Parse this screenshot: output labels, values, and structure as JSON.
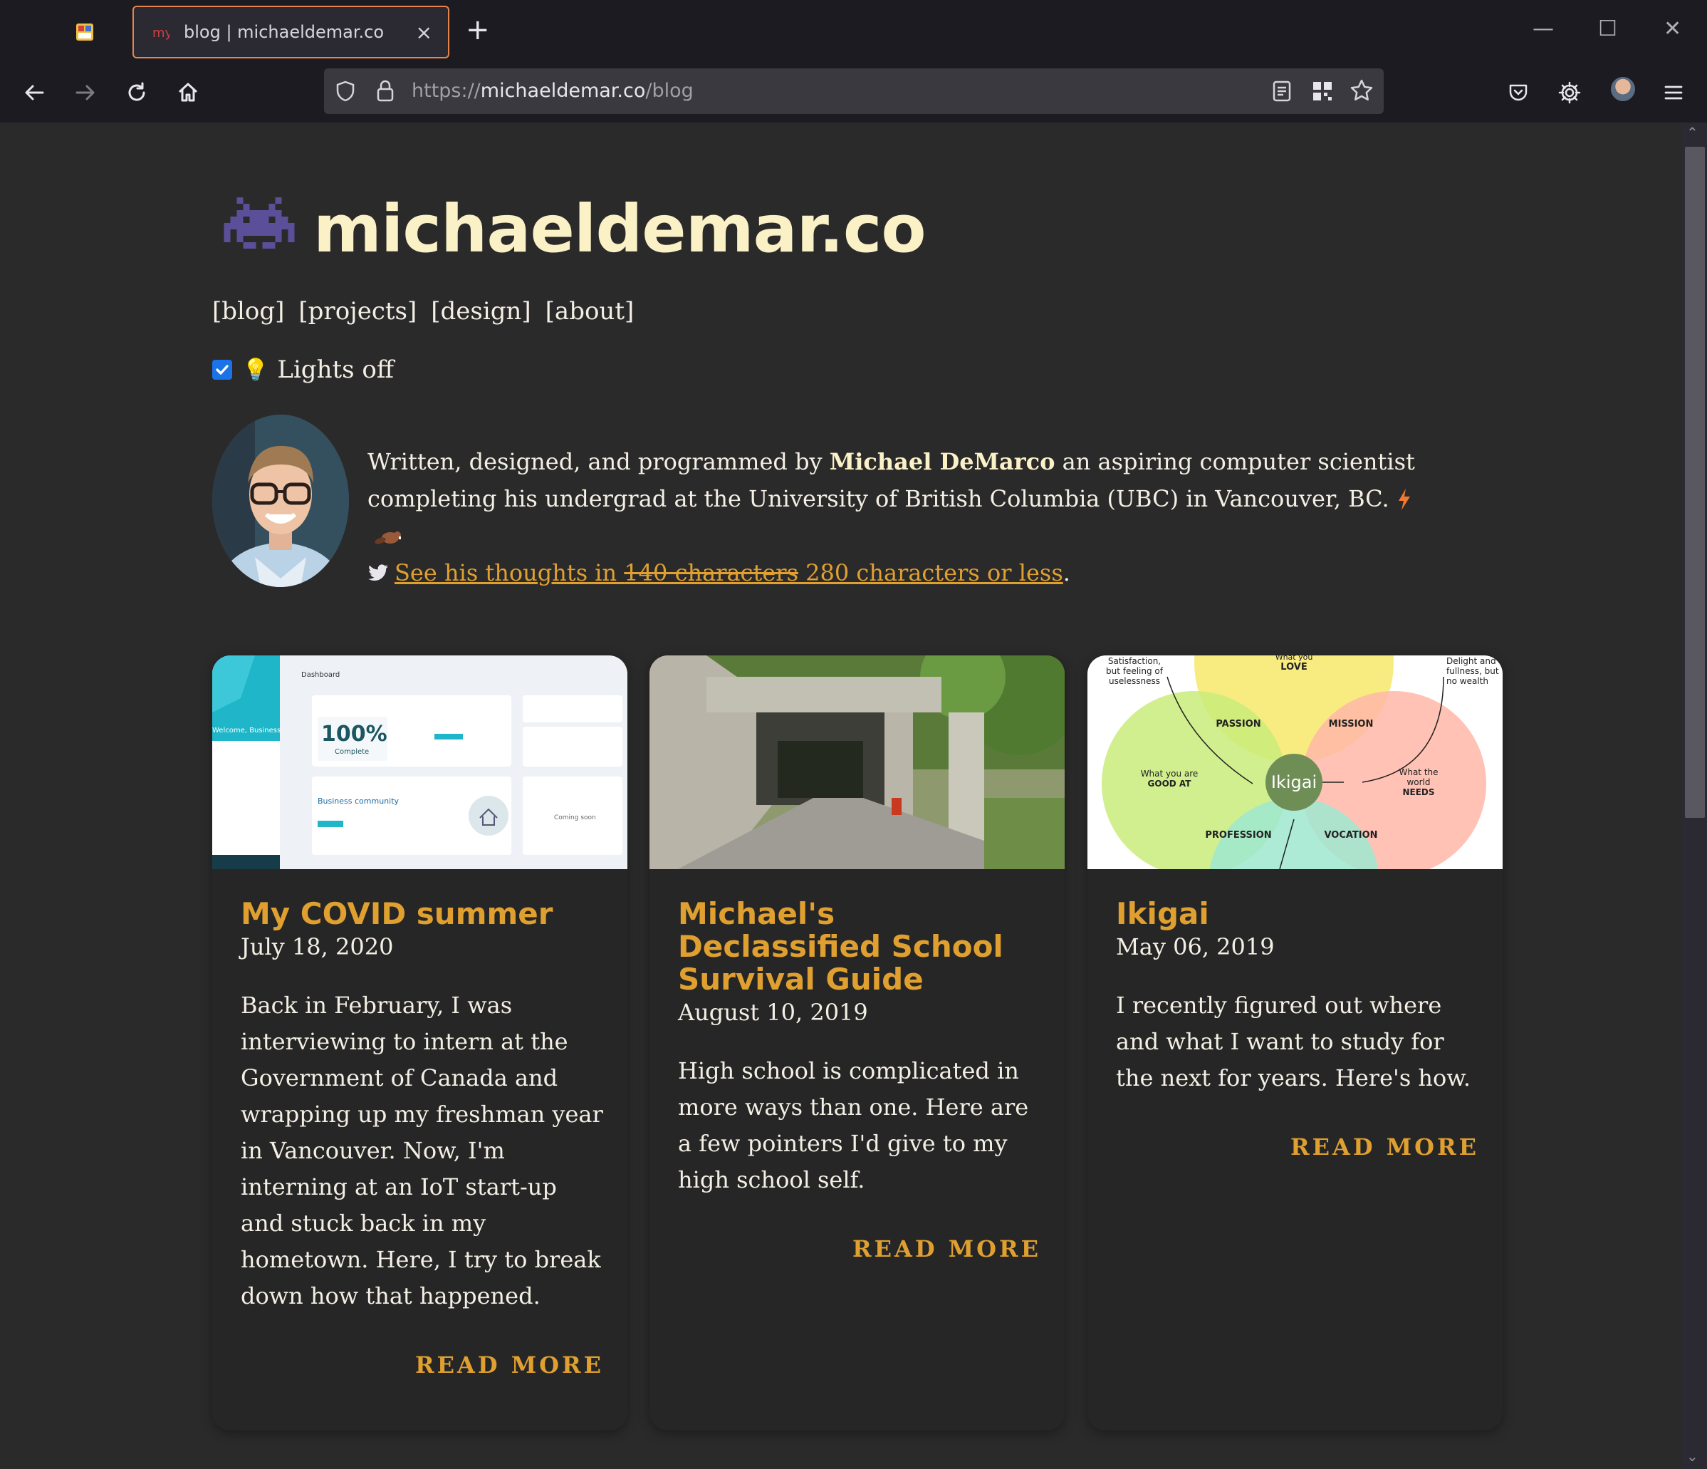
{
  "browser": {
    "tab_title": "blog | michaeldemar.co",
    "tab_close": "×",
    "new_tab": "+",
    "url_scheme": "https://",
    "url_host": "michaeldemar.co",
    "url_path": "/blog",
    "window_minimize": "—",
    "window_maximize": "☐",
    "window_close": "✕"
  },
  "site": {
    "title": "michaeldemar.co",
    "nav": [
      "[blog]",
      "[projects]",
      "[design]",
      "[about]"
    ],
    "lights_label": "Lights off",
    "lights_checked": true
  },
  "bio": {
    "prefix": "Written, designed, and programmed by ",
    "name": "Michael DeMarco",
    "suffix": " an aspiring computer scientist completing his undergrad at the University of British Columbia (UBC) in Vancouver, BC. ",
    "twitter_prefix": "See his thoughts in ",
    "twitter_struck": "140 characters",
    "twitter_suffix": " 280 characters or less",
    "period": "."
  },
  "posts": [
    {
      "title": "My COVID summer",
      "date": "July 18, 2020",
      "excerpt": "Back in February, I was interviewing to intern at the Government of Canada and wrapping up my freshman year in Vancouver. Now, I'm interning at an IoT start-up and stuck back in my hometown. Here, I try to break down how that happened.",
      "read_more": "READ MORE",
      "thumb": {
        "welcome": "Welcome, Business",
        "dashboard": "Dashboard",
        "complete_pct": "100%",
        "complete_label": "Complete",
        "community": "Business community",
        "coming_soon": "Coming soon"
      }
    },
    {
      "title": "Michael's Declassified School Survival Guide",
      "date": "August 10, 2019",
      "excerpt": "High school is complicated in more ways than one. Here are a few pointers I'd give to my high school self.",
      "read_more": "READ MORE"
    },
    {
      "title": "Ikigai",
      "date": "May 06, 2019",
      "excerpt": "I recently figured out where and what I want to study for the next for years. Here's how.",
      "read_more": "READ MORE",
      "thumb": {
        "center": "Ikigai",
        "passion": "PASSION",
        "mission": "MISSION",
        "profession": "PROFESSION",
        "vocation": "VOCATION",
        "love_pre": "What you",
        "love": "LOVE",
        "good_pre": "What you are",
        "good": "GOOD AT",
        "needs_pre1": "What the",
        "needs_pre2": "world",
        "needs": "NEEDS",
        "note_left1": "Satisfaction,",
        "note_left2": "but feeling of",
        "note_left3": "uselessness",
        "note_right1": "Delight and",
        "note_right2": "fullness, but",
        "note_right3": "no wealth"
      }
    }
  ],
  "colors": {
    "accent": "#e0a030",
    "title": "#fbf1c7",
    "background": "#2b2a2a",
    "card": "#262626"
  }
}
